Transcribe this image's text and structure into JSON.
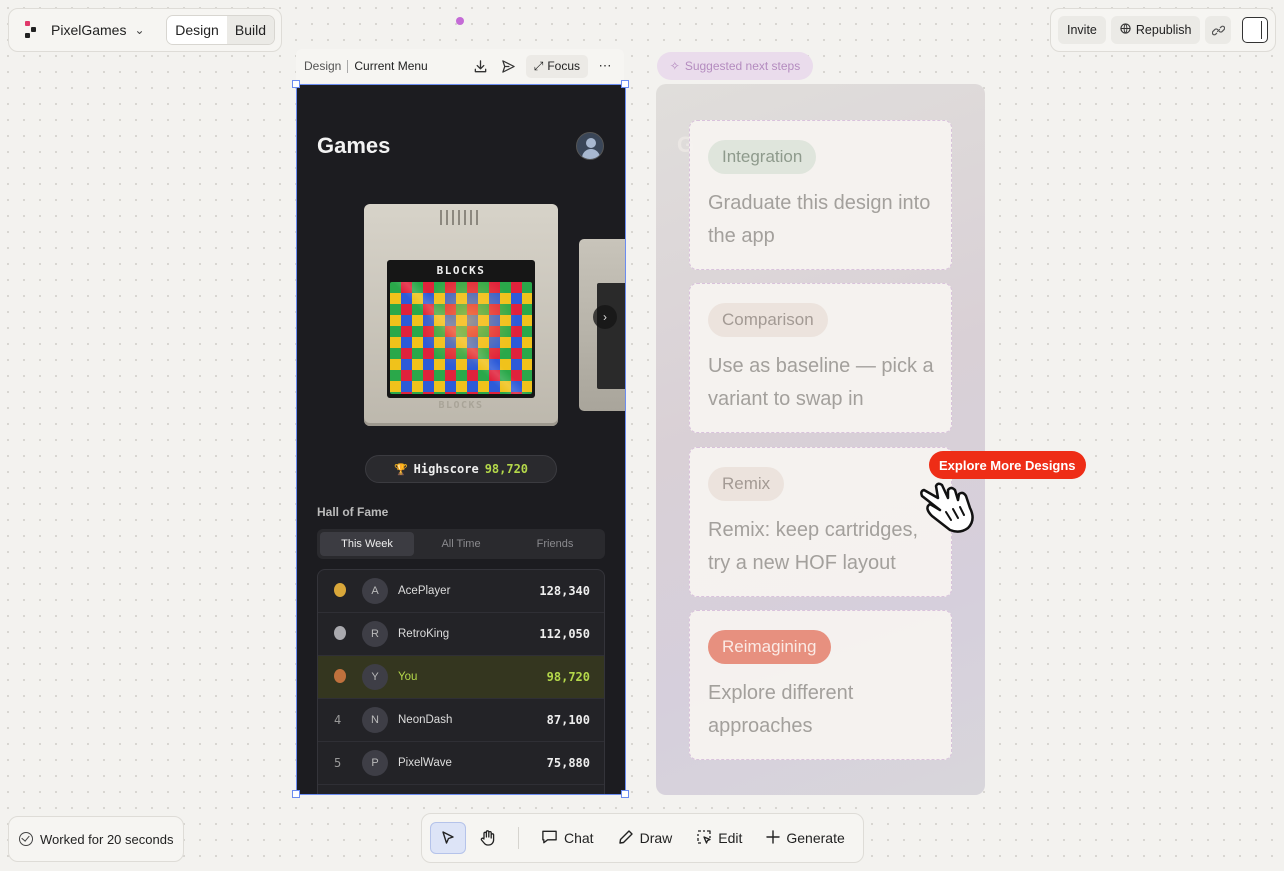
{
  "topbar": {
    "project_name": "PixelGames",
    "modes": [
      "Design",
      "Build"
    ],
    "active_mode": "Design"
  },
  "actions": {
    "invite": "Invite",
    "republish": "Republish"
  },
  "frame_header": {
    "section": "Design",
    "name": "Current Menu",
    "focus": "Focus"
  },
  "app": {
    "title": "Games",
    "cartridge_title": "BLOCKS",
    "cartridge_embossed": "BLOCKS",
    "next_glyph": "›",
    "highscore_label": "Highscore",
    "highscore_value": "98,720",
    "hof_title": "Hall of Fame",
    "tabs": [
      "This Week",
      "All Time",
      "Friends"
    ],
    "leaderboard": [
      {
        "rank": "",
        "medal": "#d9a73a",
        "initial": "A",
        "name": "AcePlayer",
        "score": "128,340"
      },
      {
        "rank": "",
        "medal": "#a9a9ae",
        "initial": "R",
        "name": "RetroKing",
        "score": "112,050"
      },
      {
        "rank": "",
        "medal": "#c0713d",
        "initial": "Y",
        "name": "You",
        "score": "98,720",
        "me": true
      },
      {
        "rank": "4",
        "initial": "N",
        "name": "NeonDash",
        "score": "87,100"
      },
      {
        "rank": "5",
        "initial": "P",
        "name": "PixelWave",
        "score": "75,880"
      }
    ]
  },
  "suggestions": {
    "pill": "Suggested next steps",
    "cards": [
      {
        "tag": "Integration",
        "text": "Graduate this design into the app",
        "tag_bg": "#dfe5dc",
        "tag_color": "#8e9a8c"
      },
      {
        "tag": "Comparison",
        "text": "Use as baseline — pick a variant to swap in",
        "tag_bg": "#ece3dd",
        "tag_color": "#a39a94"
      },
      {
        "tag": "Remix",
        "text": "Remix: keep cartridges, try a new HOF layout",
        "tag_bg": "#ece3dd",
        "tag_color": "#a39a94"
      },
      {
        "tag": "Reimagining",
        "text": "Explore different approaches",
        "tag_bg": "#e7907f",
        "tag_color": "#fbeae5"
      }
    ],
    "explore": "Explore More Designs"
  },
  "status": {
    "worked": "Worked for 20 seconds"
  },
  "toolbar": {
    "chat": "Chat",
    "draw": "Draw",
    "edit": "Edit",
    "generate": "Generate"
  },
  "colors": {
    "selection": "#6b8cf0",
    "accent_green": "#b4d84a",
    "explore_red": "#ee2d16"
  }
}
